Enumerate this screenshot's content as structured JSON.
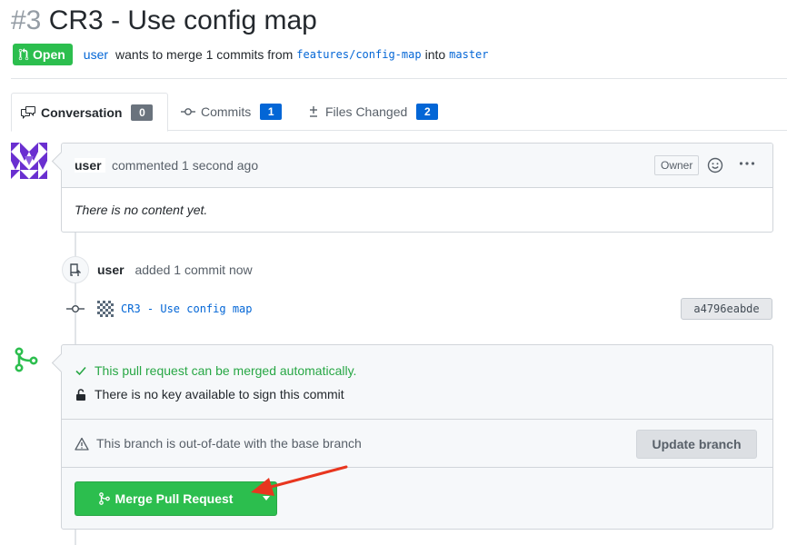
{
  "pull_request": {
    "number": "#3",
    "title": "CR3 - Use config map",
    "state": "Open",
    "author": "user",
    "summary_text": "wants to merge 1 commits from",
    "source_branch": "features/config-map",
    "into_text": "into",
    "target_branch": "master"
  },
  "tabs": [
    {
      "label": "Conversation",
      "count": "0",
      "icon": "comment-discussion-icon"
    },
    {
      "label": "Commits",
      "count": "1",
      "icon": "git-commit-icon"
    },
    {
      "label": "Files Changed",
      "count": "2",
      "icon": "diff-icon"
    }
  ],
  "comment": {
    "author": "user",
    "action": "commented",
    "time": "1 second ago",
    "role_badge": "Owner",
    "body": "There is no content yet."
  },
  "event": {
    "who": "user",
    "what": "added 1 commit now"
  },
  "commit": {
    "message": "CR3 - Use config map",
    "sha": "a4796eabde"
  },
  "merge_box": {
    "mergeable_text": "This pull request can be merged automatically.",
    "sign_text": "There is no key available to sign this commit",
    "outdated_text": "This branch is out-of-date with the base branch",
    "update_button": "Update branch",
    "merge_button": "Merge Pull Request"
  },
  "colors": {
    "open_green": "#2cbe4e",
    "link_blue": "#0366d6",
    "annotation_red": "#e8361f"
  }
}
